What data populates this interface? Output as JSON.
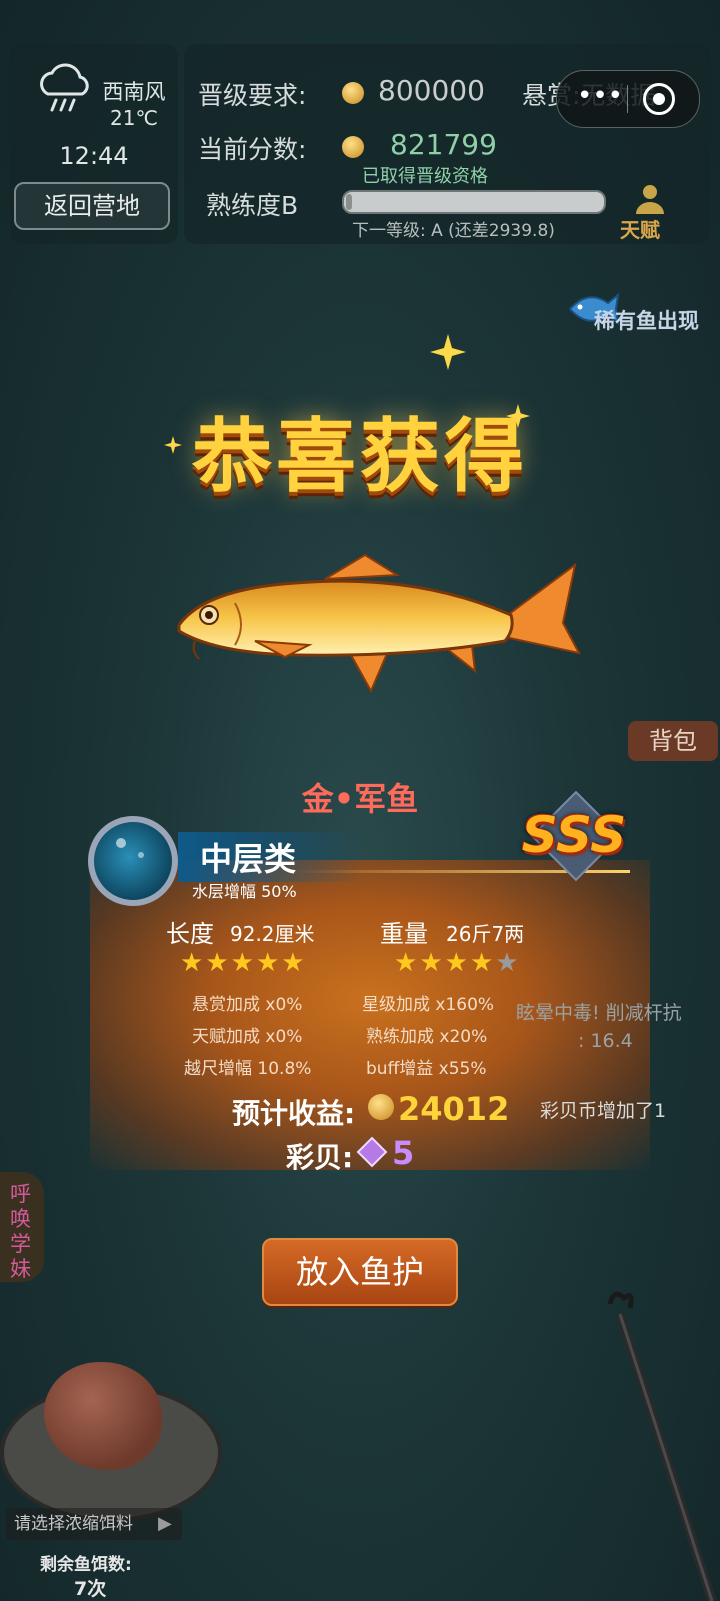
{
  "weather": {
    "wind": "西南风",
    "temperature": "21℃",
    "time": "12:44",
    "back_button": "返回营地"
  },
  "promotion": {
    "requirement_label": "晋级要求:",
    "requirement_value": "800000",
    "bounty_label": "悬赏:无数据",
    "current_label": "当前分数:",
    "current_value": "821799",
    "qualified_text": "已取得晋级资格",
    "proficiency_label": "熟练度B",
    "proficiency_progress": 0.02,
    "next_level_text": "下一等级: A (还差2939.8)",
    "talent_label": "天赋"
  },
  "rare_fish_text": "稀有鱼出现",
  "title": "恭喜获得",
  "bag_button": "背包",
  "fish": {
    "name": "金•军鱼",
    "grade": "SSS",
    "layer_name": "中层类",
    "layer_boost": "水层增幅 50%",
    "length_label": "长度",
    "length_value": "92.2厘米",
    "length_stars": 5,
    "weight_label": "重量",
    "weight_value": "26斤7两",
    "weight_stars": 4,
    "max_stars": 5,
    "stats": {
      "bounty_bonus": "悬赏加成 x0%",
      "star_bonus": "星级加成 x160%",
      "talent_bonus": "天赋加成 x0%",
      "proficiency_bonus": "熟练加成 x20%",
      "oversize_boost": "越尺增幅 10.8%",
      "buff_gain": "buff增益 x55%"
    },
    "income_label": "预计收益:",
    "income_value": "24012",
    "shell_label": "彩贝:",
    "shell_value": "5"
  },
  "notes": {
    "poison": "眩晕中毒! 削减杆抗",
    "poison_value": ": 16.4",
    "shell_increase": "彩贝币增加了1"
  },
  "put_button": "放入鱼护",
  "summon_button": "呼唤学妹",
  "bait": {
    "select_placeholder": "请选择浓缩饵料",
    "remaining_label": "剩余鱼饵数:",
    "remaining_count": "7次"
  },
  "colors": {
    "title_gold": "#ffd23e",
    "fish_name_red": "#ff6a5a",
    "income_gold": "#ffd33a",
    "shell_purple": "#c88cff",
    "qualified_green": "#8fd0a9"
  }
}
